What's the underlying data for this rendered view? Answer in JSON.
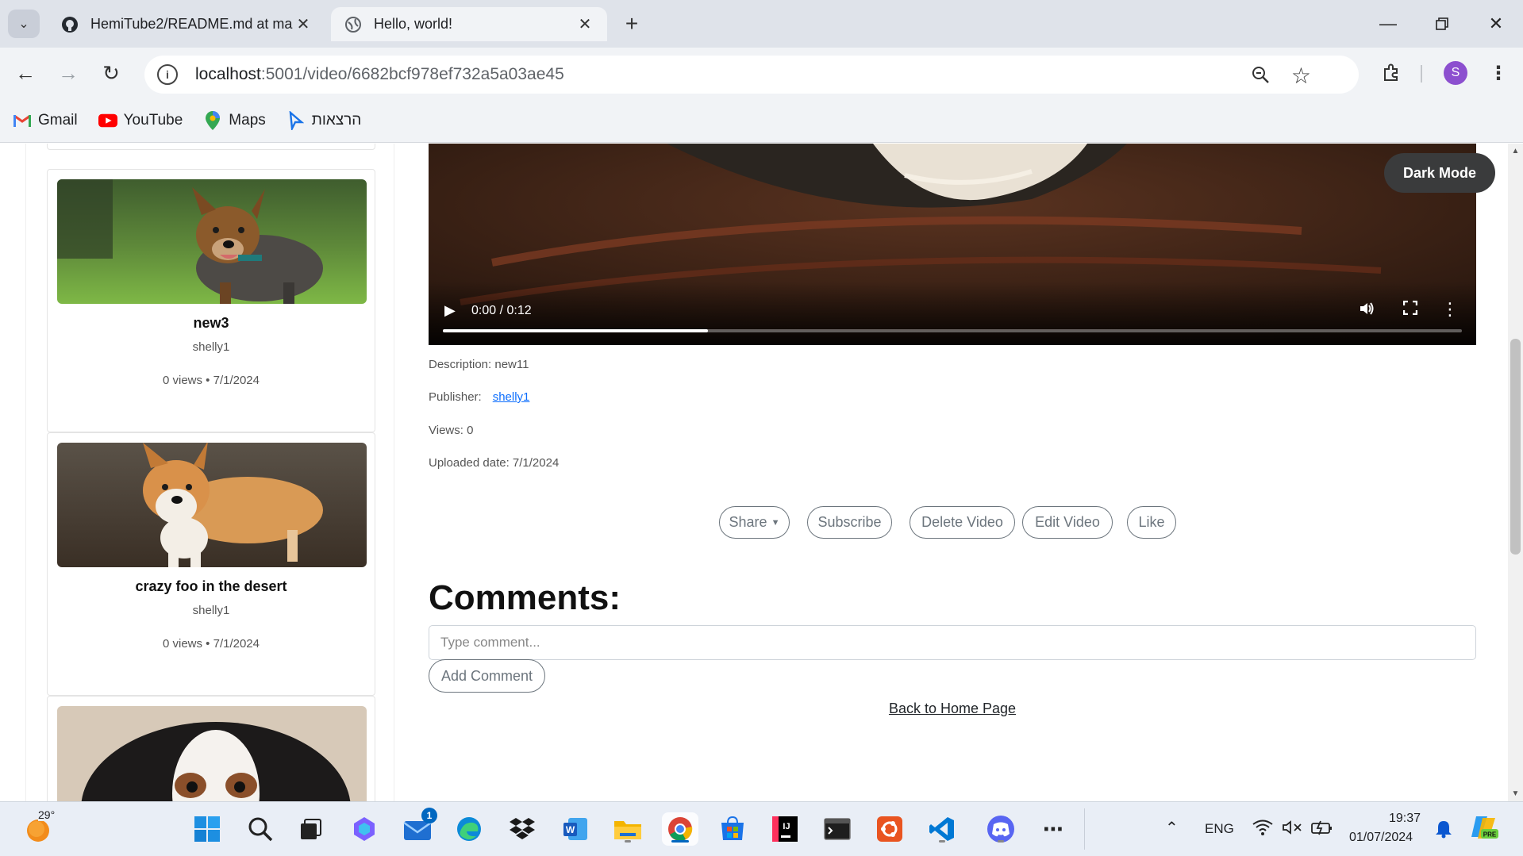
{
  "browser": {
    "tabs": [
      {
        "title": "HemiTube2/README.md at ma",
        "active": false,
        "icon": "github-icon"
      },
      {
        "title": "Hello, world!",
        "active": true,
        "icon": "globe-icon"
      }
    ],
    "url_host": "localhost",
    "url_path": ":5001/video/6682bcf978ef732a5a03ae45",
    "profile_initial": "S",
    "bookmarks": [
      {
        "label": "Gmail",
        "icon": "gmail-icon",
        "color": "#ea4335"
      },
      {
        "label": "YouTube",
        "icon": "youtube-icon",
        "color": "#ff0000"
      },
      {
        "label": "Maps",
        "icon": "maps-icon",
        "color": "#34a853"
      },
      {
        "label": "הרצאות",
        "icon": "lecture-icon",
        "color": "#1a73e8"
      }
    ]
  },
  "sidebar": {
    "videos": [
      {
        "title": "new3",
        "author": "shelly1",
        "meta": "0 views • 7/1/2024",
        "thumb": "dog-running-grass"
      },
      {
        "title": "crazy foo in the desert",
        "author": "shelly1",
        "meta": "0 views • 7/1/2024",
        "thumb": "corgi-dirt"
      }
    ]
  },
  "video": {
    "time": "0:00 / 0:12",
    "progress_fraction": 0.26
  },
  "details": {
    "description": "Description: new11",
    "publisher_label": "Publisher:",
    "publisher": "shelly1",
    "views": "Views: 0",
    "uploaded": "Uploaded date: 7/1/2024"
  },
  "actions": {
    "share": "Share",
    "subscribe": "Subscribe",
    "delete": "Delete Video",
    "edit": "Edit Video",
    "like": "Like"
  },
  "comments": {
    "title": "Comments:",
    "placeholder": "Type comment...",
    "add_label": "Add Comment"
  },
  "back_home": "Back to Home Page",
  "dark_mode": "Dark Mode",
  "taskbar": {
    "weather": "29°",
    "mail_badge": "1",
    "language": "ENG",
    "time": "19:37",
    "date": "01/07/2024"
  }
}
